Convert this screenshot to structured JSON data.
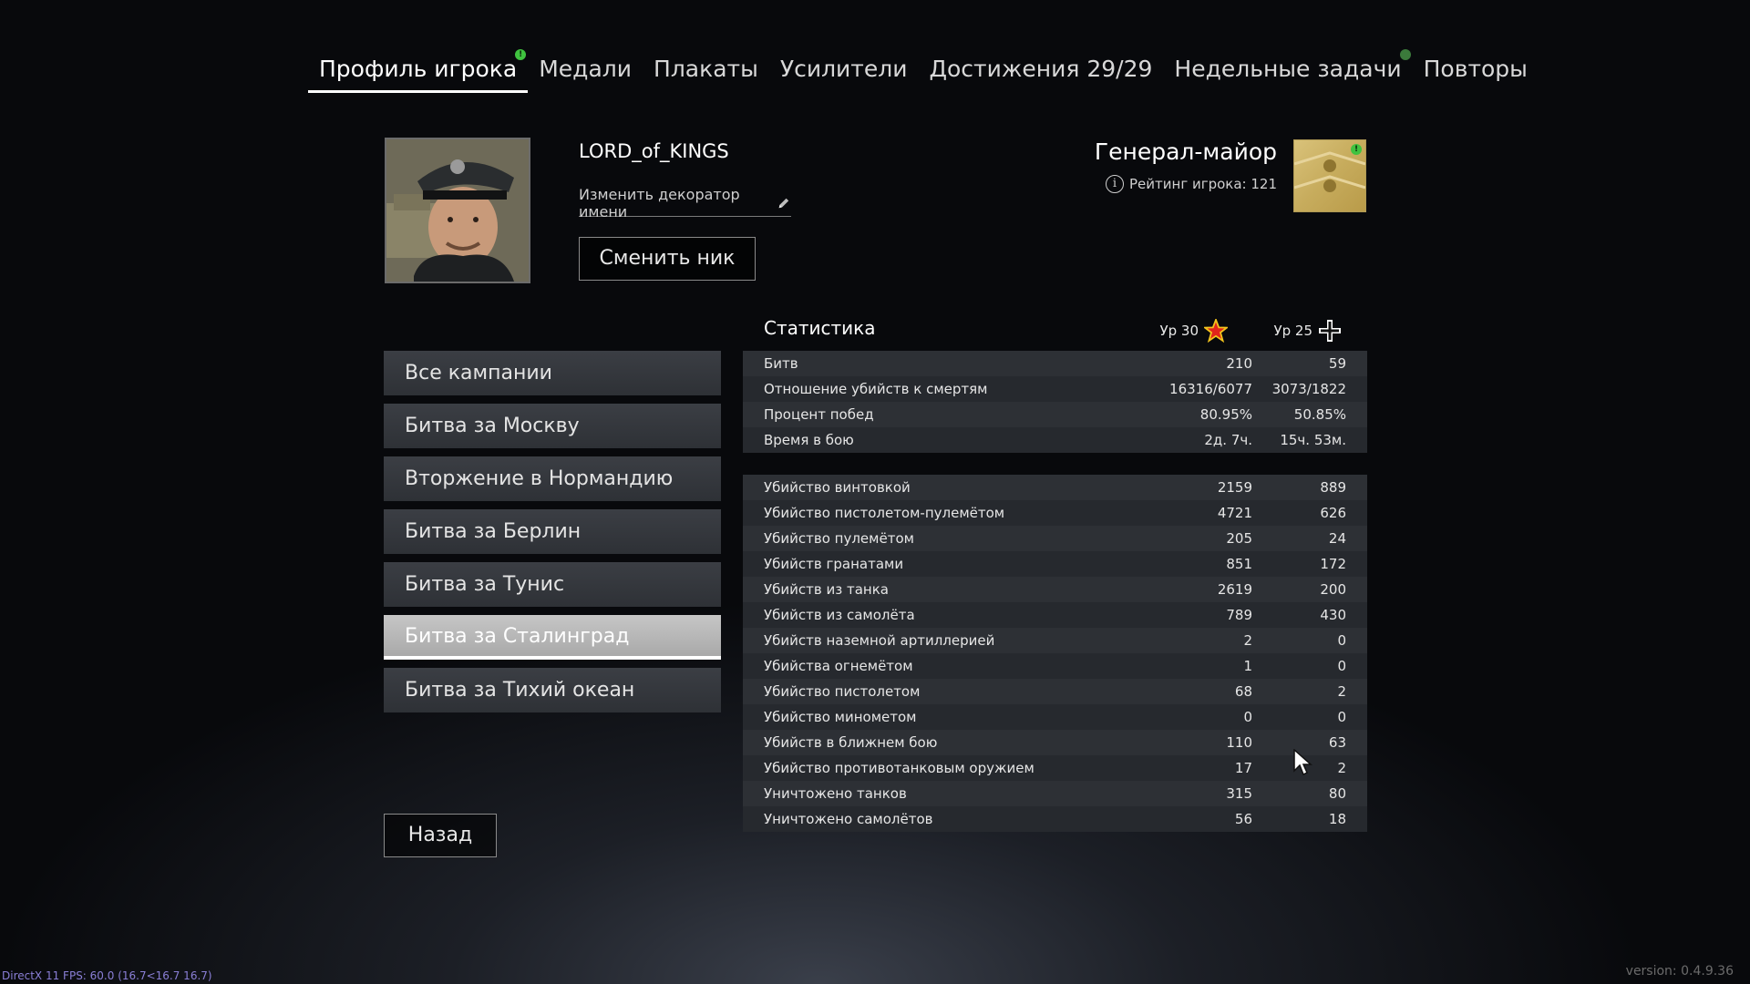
{
  "tabs": [
    {
      "label": "Профиль игрока",
      "active": true,
      "notify": true
    },
    {
      "label": "Медали",
      "active": false,
      "notify": false
    },
    {
      "label": "Плакаты",
      "active": false,
      "notify": false
    },
    {
      "label": "Усилители",
      "active": false,
      "notify": false
    },
    {
      "label": "Достижения 29/29",
      "active": false,
      "notify": false
    },
    {
      "label": "Недельные задачи",
      "active": false,
      "notify": true
    },
    {
      "label": "Повторы",
      "active": false,
      "notify": false
    }
  ],
  "profile": {
    "username": "LORD_of_KINGS",
    "decorator_link": "Изменить декоратор имени",
    "change_nick_button": "Сменить ник",
    "rank_title": "Генерал-майор",
    "rating_label": "Рейтинг игрока: 121",
    "notify_mark": "!"
  },
  "campaigns": [
    {
      "label": "Все кампании",
      "active": false
    },
    {
      "label": "Битва за Москву",
      "active": false
    },
    {
      "label": "Вторжение в Нормандию",
      "active": false
    },
    {
      "label": "Битва за Берлин",
      "active": false
    },
    {
      "label": "Битва за Тунис",
      "active": false
    },
    {
      "label": "Битва за Сталинград",
      "active": true
    },
    {
      "label": "Битва за Тихий океан",
      "active": false
    }
  ],
  "back_button": "Назад",
  "stats": {
    "title": "Статистика",
    "level1_label": "Ур 30",
    "level2_label": "Ур 25",
    "summary_rows": [
      {
        "label": "Битв",
        "v1": "210",
        "v2": "59"
      },
      {
        "label": "Отношение убийств к смертям",
        "v1": "16316/6077",
        "v2": "3073/1822"
      },
      {
        "label": "Процент побед",
        "v1": "80.95%",
        "v2": "50.85%"
      },
      {
        "label": "Время в бою",
        "v1": "2д. 7ч.",
        "v2": "15ч. 53м."
      }
    ],
    "kill_rows": [
      {
        "label": "Убийство винтовкой",
        "v1": "2159",
        "v2": "889"
      },
      {
        "label": "Убийство пистолетом-пулемётом",
        "v1": "4721",
        "v2": "626"
      },
      {
        "label": "Убийство пулемётом",
        "v1": "205",
        "v2": "24"
      },
      {
        "label": "Убийств гранатами",
        "v1": "851",
        "v2": "172"
      },
      {
        "label": "Убийств из танка",
        "v1": "2619",
        "v2": "200"
      },
      {
        "label": "Убийств из самолёта",
        "v1": "789",
        "v2": "430"
      },
      {
        "label": "Убийств наземной артиллерией",
        "v1": "2",
        "v2": "0"
      },
      {
        "label": "Убийства огнемётом",
        "v1": "1",
        "v2": "0"
      },
      {
        "label": "Убийство пистолетом",
        "v1": "68",
        "v2": "2"
      },
      {
        "label": "Убийство минометом",
        "v1": "0",
        "v2": "0"
      },
      {
        "label": "Убийств в ближнем бою",
        "v1": "110",
        "v2": "63"
      },
      {
        "label": "Убийство противотанковым оружием",
        "v1": "17",
        "v2": "2"
      },
      {
        "label": "Уничтожено танков",
        "v1": "315",
        "v2": "80"
      },
      {
        "label": "Уничтожено самолётов",
        "v1": "56",
        "v2": "18"
      }
    ]
  },
  "footer": {
    "fps": "DirectX 11 FPS: 60.0 (16.7<16.7 16.7)",
    "version": "version: 0.4.9.36"
  },
  "colors": {
    "notify_green": "#3fc23f",
    "active_campaign": "#b5b5b5",
    "rank_gold": "#c7ac5d",
    "star_red": "#e0241b",
    "star_yellow": "#f2c31c"
  },
  "icons": [
    "notification-dot-icon",
    "pencil-icon",
    "info-icon",
    "rank-insignia-icon",
    "star-icon",
    "iron-cross-icon",
    "mouse-cursor-icon"
  ]
}
